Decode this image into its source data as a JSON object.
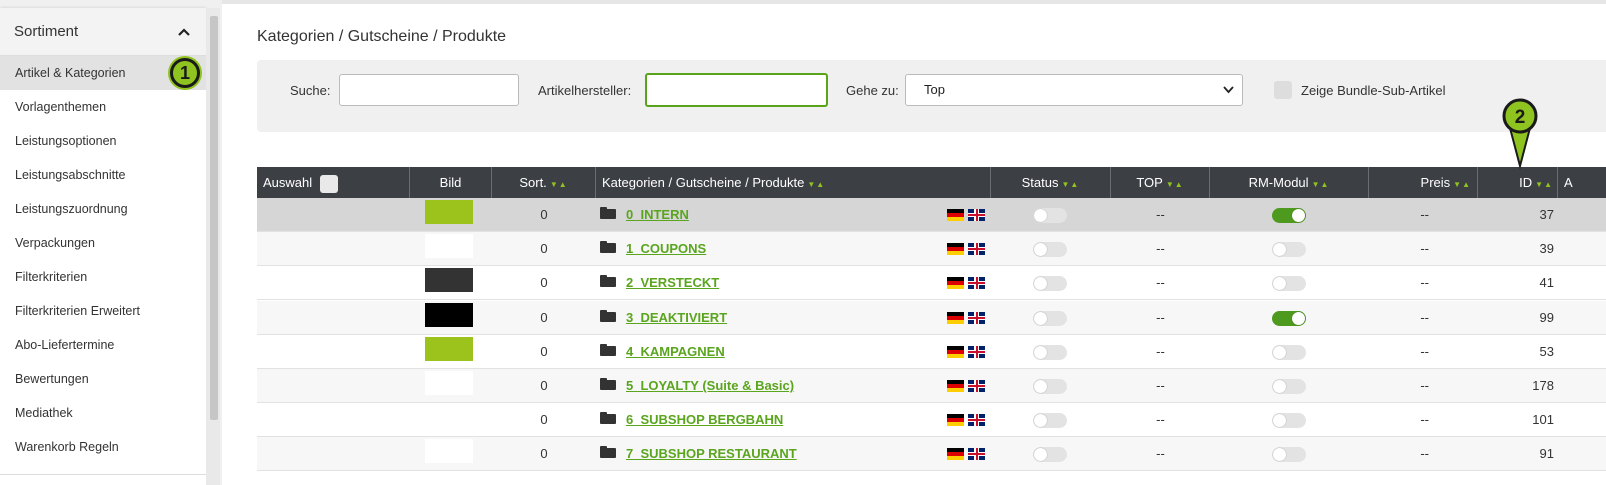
{
  "sidebar": {
    "header": "Sortiment",
    "items": [
      "Artikel & Kategorien",
      "Vorlagenthemen",
      "Leistungsoptionen",
      "Leistungsabschnitte",
      "Leistungszuordnung",
      "Verpackungen",
      "Filterkriterien",
      "Filterkriterien Erweitert",
      "Abo-Liefertermine",
      "Bewertungen",
      "Mediathek",
      "Warenkorb Regeln"
    ],
    "active_index": 0
  },
  "badges": {
    "one": "1",
    "two": "2"
  },
  "main": {
    "title": "Kategorien / Gutscheine / Produkte",
    "filters": {
      "search_label": "Suche:",
      "search_value": "",
      "manufacturer_label": "Artikelhersteller:",
      "manufacturer_value": "",
      "goto_label": "Gehe zu:",
      "goto_value": "Top",
      "bundle_label": "Zeige Bundle-Sub-Artikel"
    },
    "table": {
      "headers": {
        "auswahl": "Auswahl",
        "bild": "Bild",
        "sort": "Sort.",
        "name": "Kategorien / Gutscheine / Produkte",
        "status": "Status",
        "top": "TOP",
        "rm": "RM-Modul",
        "preis": "Preis",
        "id": "ID",
        "extra": "A"
      },
      "rows": [
        {
          "sort": "0",
          "name": "0_INTERN",
          "top": "--",
          "rm_on": true,
          "preis": "--",
          "id": "37",
          "image_color": "#9bc31c"
        },
        {
          "sort": "0",
          "name": "1_COUPONS",
          "top": "--",
          "rm_on": false,
          "preis": "--",
          "id": "39",
          "image_color": "#ffffff"
        },
        {
          "sort": "0",
          "name": "2_VERSTECKT",
          "top": "--",
          "rm_on": false,
          "preis": "--",
          "id": "41",
          "image_color": "#333333"
        },
        {
          "sort": "0",
          "name": "3_DEAKTIVIERT",
          "top": "--",
          "rm_on": true,
          "preis": "--",
          "id": "99",
          "image_color": "#000000"
        },
        {
          "sort": "0",
          "name": "4_KAMPAGNEN",
          "top": "--",
          "rm_on": false,
          "preis": "--",
          "id": "53",
          "image_color": "#9bc31c"
        },
        {
          "sort": "0",
          "name": "5_LOYALTY (Suite & Basic)",
          "top": "--",
          "rm_on": false,
          "preis": "--",
          "id": "178",
          "image_color": "#ffffff"
        },
        {
          "sort": "0",
          "name": "6_SUBSHOP BERGBAHN",
          "top": "--",
          "rm_on": false,
          "preis": "--",
          "id": "101",
          "image_color": "#ffffff"
        },
        {
          "sort": "0",
          "name": "7_SUBSHOP RESTAURANT",
          "top": "--",
          "rm_on": false,
          "preis": "--",
          "id": "91",
          "image_color": "#ffffff"
        }
      ]
    }
  },
  "colors": {
    "accent": "#8fc31f",
    "link": "#5aa51e",
    "toggle_on": "#4e9a1f",
    "header_bg": "#3c3f44"
  }
}
